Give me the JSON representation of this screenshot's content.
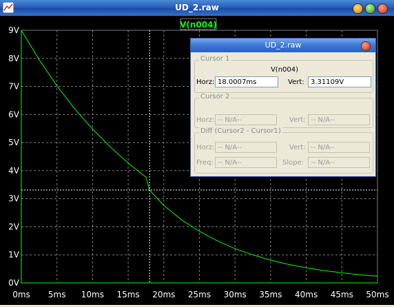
{
  "window": {
    "title": "UD_2.raw"
  },
  "plot": {
    "trace_label": "V(n004)",
    "colors": {
      "trace": "#00ff00",
      "grid": "#808080",
      "cursor": "#ffffff"
    }
  },
  "chart_data": {
    "type": "line",
    "title": "V(n004)",
    "xlabel": "",
    "ylabel": "",
    "x_unit": "ms",
    "y_unit": "V",
    "xlim": [
      0,
      50
    ],
    "ylim": [
      0,
      9
    ],
    "x_ticks": [
      "0ms",
      "5ms",
      "10ms",
      "15ms",
      "20ms",
      "25ms",
      "30ms",
      "35ms",
      "40ms",
      "45ms",
      "50ms"
    ],
    "y_ticks": [
      "0V",
      "1V",
      "2V",
      "3V",
      "4V",
      "5V",
      "6V",
      "7V",
      "8V",
      "9V"
    ],
    "grid": true,
    "series": [
      {
        "name": "V(n004)",
        "x": [
          0,
          2.5,
          5,
          7.5,
          10,
          12.5,
          15,
          17.5,
          18,
          20,
          22.5,
          25,
          27.5,
          30,
          32.5,
          35,
          37.5,
          40,
          42.5,
          45,
          47.5,
          50
        ],
        "y": [
          9.0,
          7.95,
          7.02,
          6.2,
          5.48,
          4.84,
          4.27,
          3.77,
          3.31,
          2.76,
          2.25,
          1.84,
          1.5,
          1.22,
          1.0,
          0.81,
          0.66,
          0.54,
          0.44,
          0.36,
          0.29,
          0.24
        ]
      }
    ],
    "cursor": {
      "x": 18.0007,
      "y": 3.31109
    }
  },
  "cursor_dialog": {
    "title": "UD_2.raw",
    "cursor1": {
      "group": "Cursor 1",
      "signal": "V(n004)",
      "horz_label": "Horz:",
      "horz": "18.0007ms",
      "vert_label": "Vert:",
      "vert": "3.31109V"
    },
    "cursor2": {
      "group": "Cursor 2",
      "horz_label": "Horz:",
      "horz": "-- N/A--",
      "vert_label": "Vert:",
      "vert": "-- N/A--"
    },
    "diff": {
      "group": "Diff (Cursor2 - Cursor1)",
      "horz_label": "Horz:",
      "horz": "-- N/A--",
      "vert_label": "Vert:",
      "vert": "-- N/A--",
      "freq_label": "Freq:",
      "freq": "-- N/A--",
      "slope_label": "Slope:",
      "slope": "-- N/A--"
    }
  }
}
